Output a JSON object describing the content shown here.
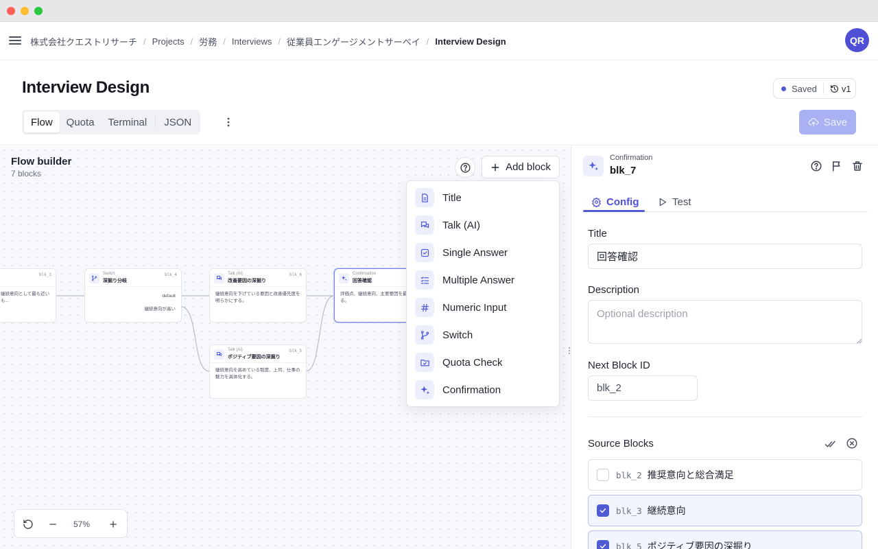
{
  "breadcrumb": [
    "株式会社クエストリサーチ",
    "Projects",
    "労務",
    "Interviews",
    "従業員エンゲージメントサーベイ",
    "Interview Design"
  ],
  "user": {
    "initials": "QR"
  },
  "header": {
    "title": "Interview Design",
    "status": "Saved",
    "version": "v1",
    "tabs": [
      "Flow",
      "Quota",
      "Terminal",
      "JSON"
    ],
    "active_tab": "Flow",
    "save_label": "Save"
  },
  "canvas": {
    "title": "Flow builder",
    "count": "7 blocks",
    "add_label": "Add block",
    "zoom": "57%",
    "nodes": [
      {
        "type": "",
        "name": "",
        "id": "blk_3",
        "desc": "継続意向として最も近いも…"
      },
      {
        "type": "Switch",
        "name": "深掘り分岐",
        "id": "blk_4",
        "desc": "",
        "branch1": "default",
        "branch2": "継続意向が高い"
      },
      {
        "type": "Talk (AI)",
        "name": "改善要因の深掘り",
        "id": "blk_6",
        "desc": "継続意向を下げている要因と改善優先度を明らかにする。"
      },
      {
        "type": "Talk (AI)",
        "name": "ポジティブ要因の深掘り",
        "id": "blk_5",
        "desc": "継続意向を高めている制度、上司、仕事の魅力を具体化する。"
      },
      {
        "type": "Confirmation",
        "name": "回答確認",
        "id": "",
        "desc": "評価点、継続意向、主要要因を最終確認する。"
      }
    ],
    "menu": [
      {
        "label": "Title",
        "icon": "document-icon"
      },
      {
        "label": "Talk (AI)",
        "icon": "chat-icon"
      },
      {
        "label": "Single Answer",
        "icon": "checkbox-icon"
      },
      {
        "label": "Multiple Answer",
        "icon": "list-check-icon"
      },
      {
        "label": "Numeric Input",
        "icon": "hash-icon"
      },
      {
        "label": "Switch",
        "icon": "branch-icon"
      },
      {
        "label": "Quota Check",
        "icon": "folder-icon"
      },
      {
        "label": "Confirmation",
        "icon": "sparkle-icon"
      }
    ]
  },
  "panel": {
    "type": "Confirmation",
    "id": "blk_7",
    "tabs": {
      "config": "Config",
      "test": "Test"
    },
    "title_label": "Title",
    "title_value": "回答確認",
    "desc_label": "Description",
    "desc_placeholder": "Optional description",
    "next_label": "Next Block ID",
    "next_value": "blk_2",
    "source_label": "Source Blocks",
    "sources": [
      {
        "id": "blk_2",
        "label": "推奨意向と総合満足",
        "checked": false
      },
      {
        "id": "blk_3",
        "label": "継続意向",
        "checked": true
      },
      {
        "id": "blk_5",
        "label": "ポジティブ要因の深掘り",
        "checked": true
      }
    ]
  },
  "colors": {
    "accent": "#4f5bd5",
    "avatar": "#4f4fd6",
    "save_disabled": "#a9b1f2"
  }
}
